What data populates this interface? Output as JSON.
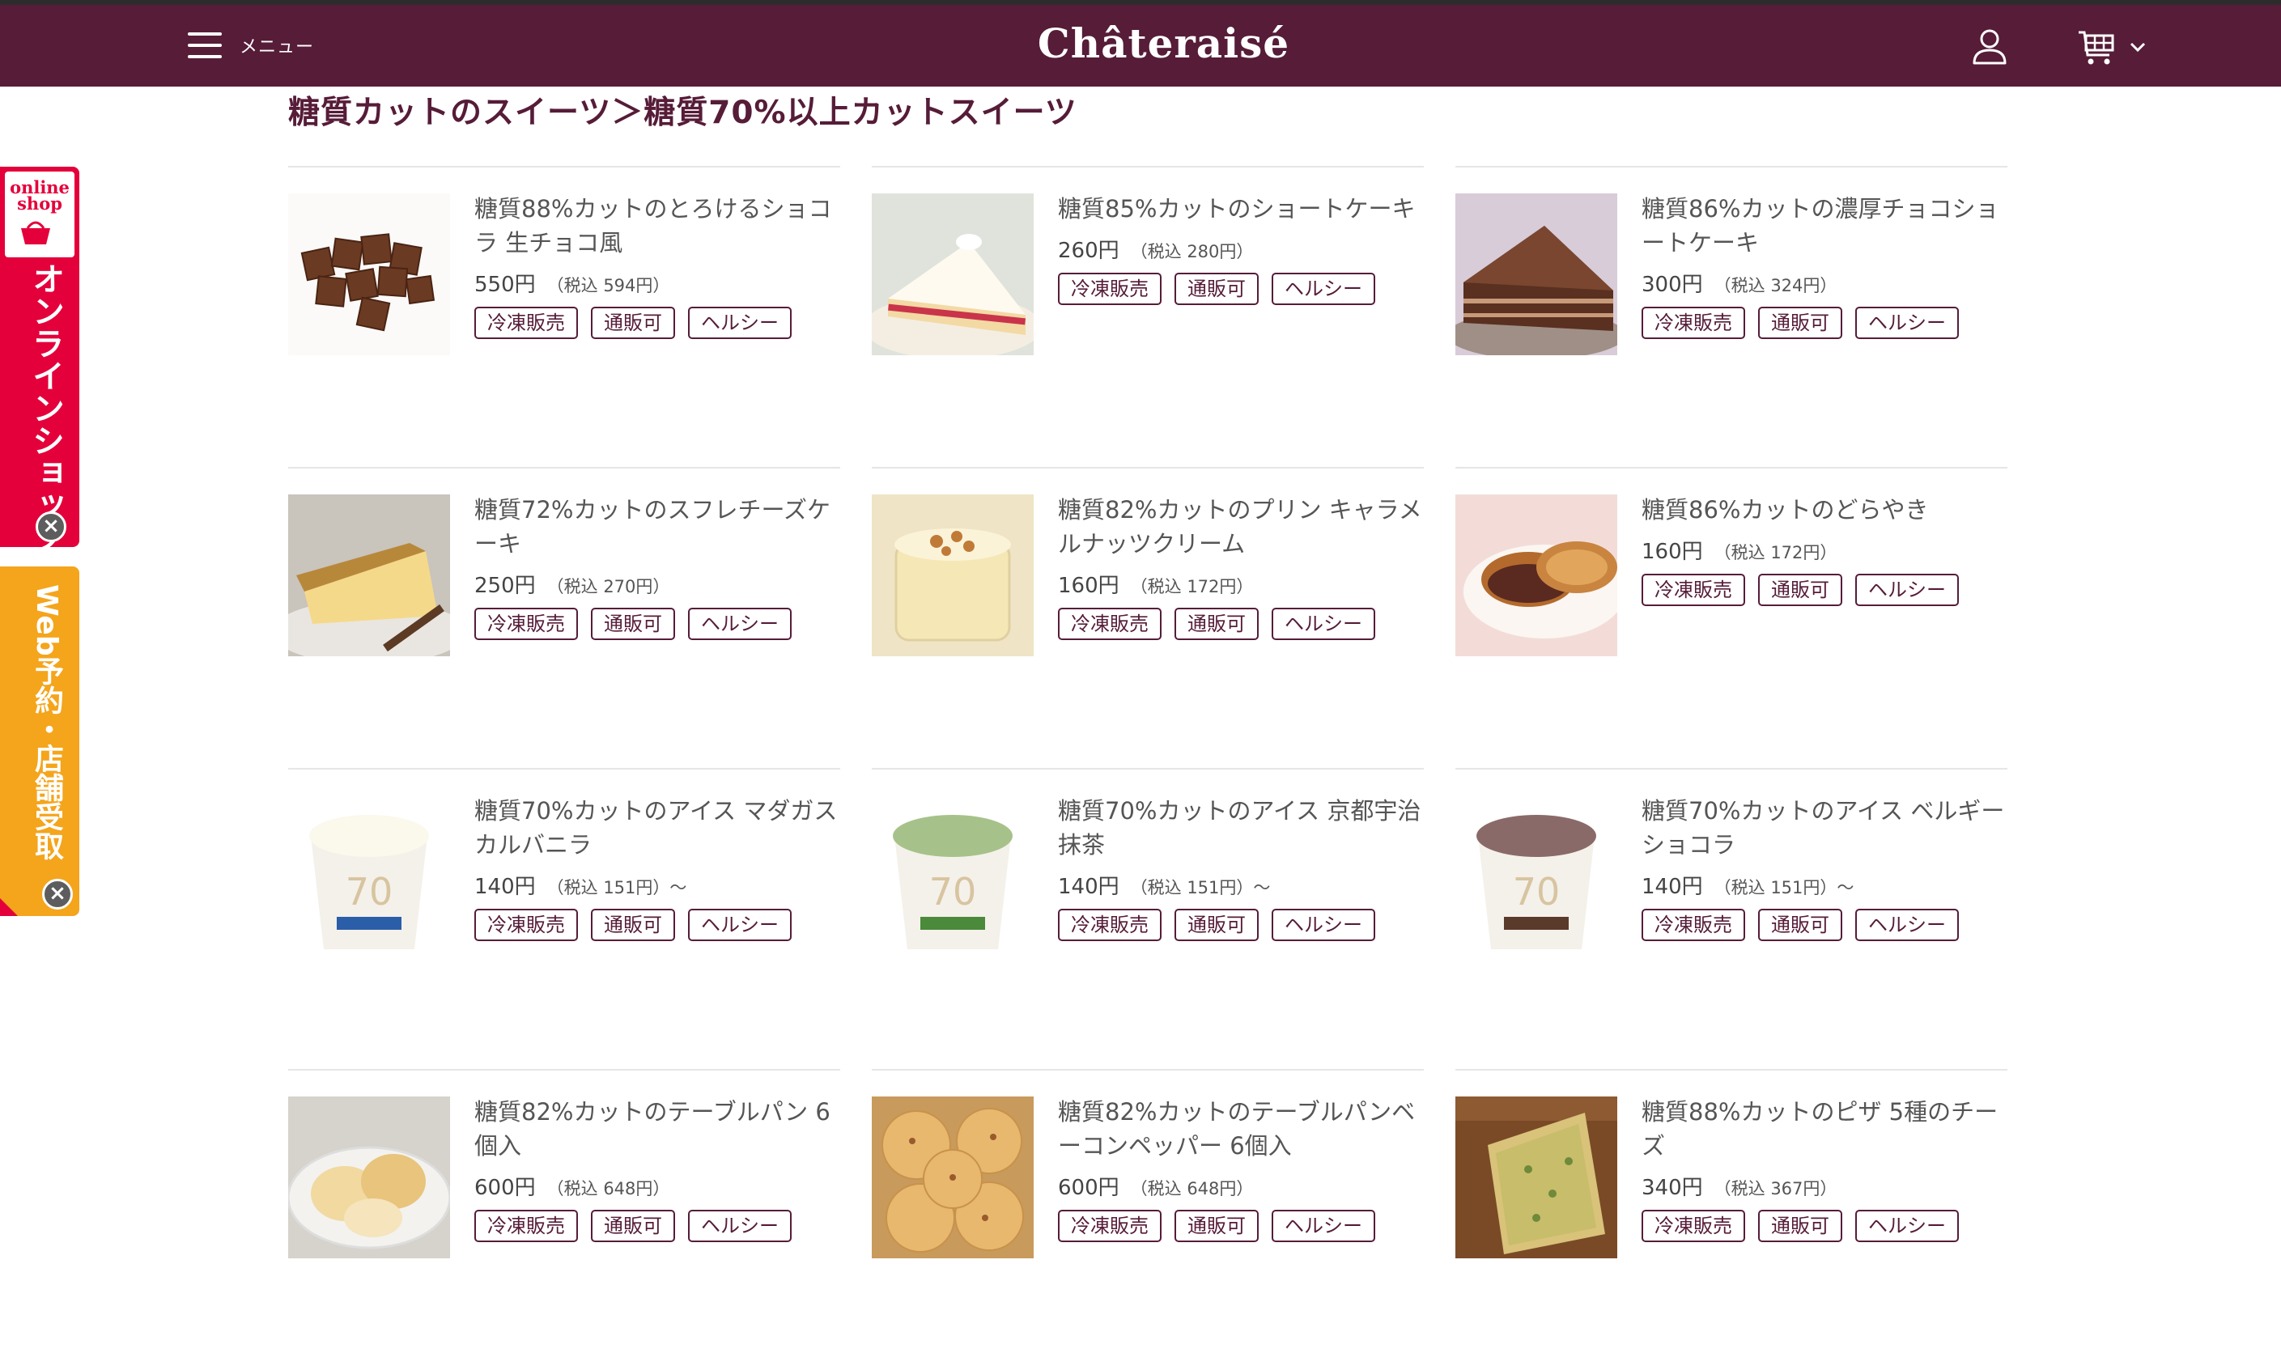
{
  "header": {
    "menu_label": "メニュー",
    "logo_text": "Châteraisé",
    "bg_color": "#561c38"
  },
  "page_title": "糖質カットのスイーツ＞糖質70%以上カットスイーツ",
  "side_tabs": {
    "online_shop_head": "online shop",
    "online_shop_text": "オンラインショップ",
    "web_reserve_text": "Web予約・店舗受取",
    "online_color": "#e4003a",
    "web_color": "#f4a51c"
  },
  "products": [
    {
      "name": "糖質88%カットのとろけるショコラ 生チョコ風",
      "price": "550円",
      "tax": "（税込 594円）",
      "tags": [
        "冷凍販売",
        "通販可",
        "ヘルシー"
      ],
      "image": "nama-choco"
    },
    {
      "name": "糖質85%カットのショートケーキ",
      "price": "260円",
      "tax": "（税込 280円）",
      "tags": [
        "冷凍販売",
        "通販可",
        "ヘルシー"
      ],
      "image": "shortcake"
    },
    {
      "name": "糖質86%カットの濃厚チョコショートケーキ",
      "price": "300円",
      "tax": "（税込 324円）",
      "tags": [
        "冷凍販売",
        "通販可",
        "ヘルシー"
      ],
      "image": "choco-cake"
    },
    {
      "name": "糖質72%カットのスフレチーズケーキ",
      "price": "250円",
      "tax": "（税込 270円）",
      "tags": [
        "冷凍販売",
        "通販可",
        "ヘルシー"
      ],
      "image": "cheesecake"
    },
    {
      "name": "糖質82%カットのプリン キャラメルナッツクリーム",
      "price": "160円",
      "tax": "（税込 172円）",
      "tags": [
        "冷凍販売",
        "通販可",
        "ヘルシー"
      ],
      "image": "pudding"
    },
    {
      "name": "糖質86%カットのどらやき",
      "price": "160円",
      "tax": "（税込 172円）",
      "tags": [
        "冷凍販売",
        "通販可",
        "ヘルシー"
      ],
      "image": "dorayaki"
    },
    {
      "name": "糖質70%カットのアイス マダガスカルバニラ",
      "price": "140円",
      "tax": "（税込 151円）～",
      "tags": [
        "冷凍販売",
        "通販可",
        "ヘルシー"
      ],
      "image": "ice-vanilla"
    },
    {
      "name": "糖質70%カットのアイス 京都宇治抹茶",
      "price": "140円",
      "tax": "（税込 151円）～",
      "tags": [
        "冷凍販売",
        "通販可",
        "ヘルシー"
      ],
      "image": "ice-matcha"
    },
    {
      "name": "糖質70%カットのアイス ベルギーショコラ",
      "price": "140円",
      "tax": "（税込 151円）～",
      "tags": [
        "冷凍販売",
        "通販可",
        "ヘルシー"
      ],
      "image": "ice-chocolate"
    },
    {
      "name": "糖質82%カットのテーブルパン 6個入",
      "price": "600円",
      "tax": "（税込 648円）",
      "tags": [
        "冷凍販売",
        "通販可",
        "ヘルシー"
      ],
      "image": "table-bread"
    },
    {
      "name": "糖質82%カットのテーブルパンベーコンペッパー 6個入",
      "price": "600円",
      "tax": "（税込 648円）",
      "tags": [
        "冷凍販売",
        "通販可",
        "ヘルシー"
      ],
      "image": "bacon-bread"
    },
    {
      "name": "糖質88%カットのピザ 5種のチーズ",
      "price": "340円",
      "tax": "（税込 367円）",
      "tags": [
        "冷凍販売",
        "通販可",
        "ヘルシー"
      ],
      "image": "pizza"
    }
  ]
}
